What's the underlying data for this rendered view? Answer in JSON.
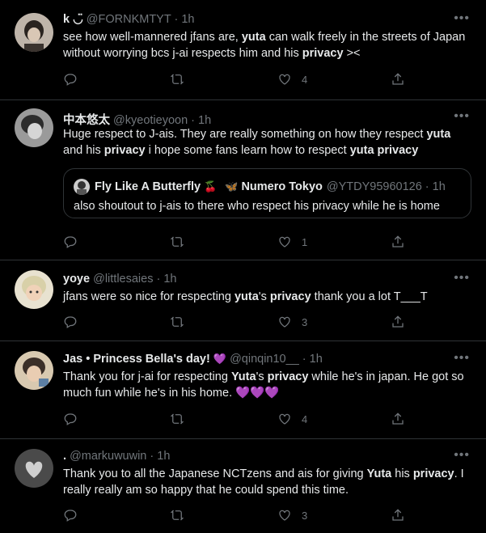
{
  "tweets": [
    {
      "name": "k ◡̈",
      "handle": "@FORNKMTYT",
      "time": "1h",
      "segments": [
        {
          "t": "see how well-mannered jfans are, ",
          "b": false
        },
        {
          "t": "yuta",
          "b": true
        },
        {
          "t": " can walk freely in the streets of Japan without worrying bcs j-ai respects him and his ",
          "b": false
        },
        {
          "t": "privacy",
          "b": true
        },
        {
          "t": " ><",
          "b": false
        }
      ],
      "likes": "4",
      "replies": "",
      "retweets": ""
    },
    {
      "name": "中本悠太",
      "handle": "@kyeotieyoon",
      "time": "1h",
      "segments": [
        {
          "t": "Huge respect to J-ais. They are really something on how they respect ",
          "b": false
        },
        {
          "t": "yuta",
          "b": true
        },
        {
          "t": " and his ",
          "b": false
        },
        {
          "t": "privacy",
          "b": true
        },
        {
          "t": " i hope some fans learn how to respect ",
          "b": false
        },
        {
          "t": "yuta privacy",
          "b": true
        }
      ],
      "quote": {
        "name": "Fly Like A Butterfly",
        "emoji1": "🍒",
        "emoji2": "🦋",
        "name2": "Numero Tokyo",
        "handle": "@YTDY95960126",
        "time": "1h",
        "text": "also shoutout to j-ais to there who respect his privacy while he is home"
      },
      "likes": "1"
    },
    {
      "name": "yoye",
      "handle": "@littlesaies",
      "time": "1h",
      "segments": [
        {
          "t": "jfans were so nice for respecting ",
          "b": false
        },
        {
          "t": "yuta",
          "b": true
        },
        {
          "t": "'s ",
          "b": false
        },
        {
          "t": "privacy",
          "b": true
        },
        {
          "t": " thank you a lot T___T",
          "b": false
        }
      ],
      "likes": "3"
    },
    {
      "name": "Jas • Princess Bella's day!",
      "name_emoji": "💜",
      "handle": "@qinqin10__",
      "time": "1h",
      "segments": [
        {
          "t": "Thank you for j-ai for respecting ",
          "b": false
        },
        {
          "t": "Yuta",
          "b": true
        },
        {
          "t": "'s ",
          "b": false
        },
        {
          "t": "privacy",
          "b": true
        },
        {
          "t": " while he's in japan. He got so much fun while he's in his home. ",
          "b": false
        },
        {
          "t": "💜💜💜",
          "b": false
        }
      ],
      "likes": "4"
    },
    {
      "name": ".",
      "handle": "@markuwuwin",
      "time": "1h",
      "segments": [
        {
          "t": "Thank you to all the Japanese NCTzens and ais for giving ",
          "b": false
        },
        {
          "t": "Yuta",
          "b": true
        },
        {
          "t": " his ",
          "b": false
        },
        {
          "t": "privacy",
          "b": true
        },
        {
          "t": ". I really really am so happy that he could spend this time.",
          "b": false
        }
      ],
      "likes": "3"
    }
  ],
  "separator": "·",
  "more_glyph": "•••",
  "colors": {
    "background": "#000000",
    "text": "#e7e9ea",
    "muted": "#71767b",
    "border": "#2f3336",
    "purple_heart": "#a970ff"
  },
  "icons": [
    "reply-icon",
    "retweet-icon",
    "like-icon",
    "share-icon",
    "more-icon"
  ]
}
